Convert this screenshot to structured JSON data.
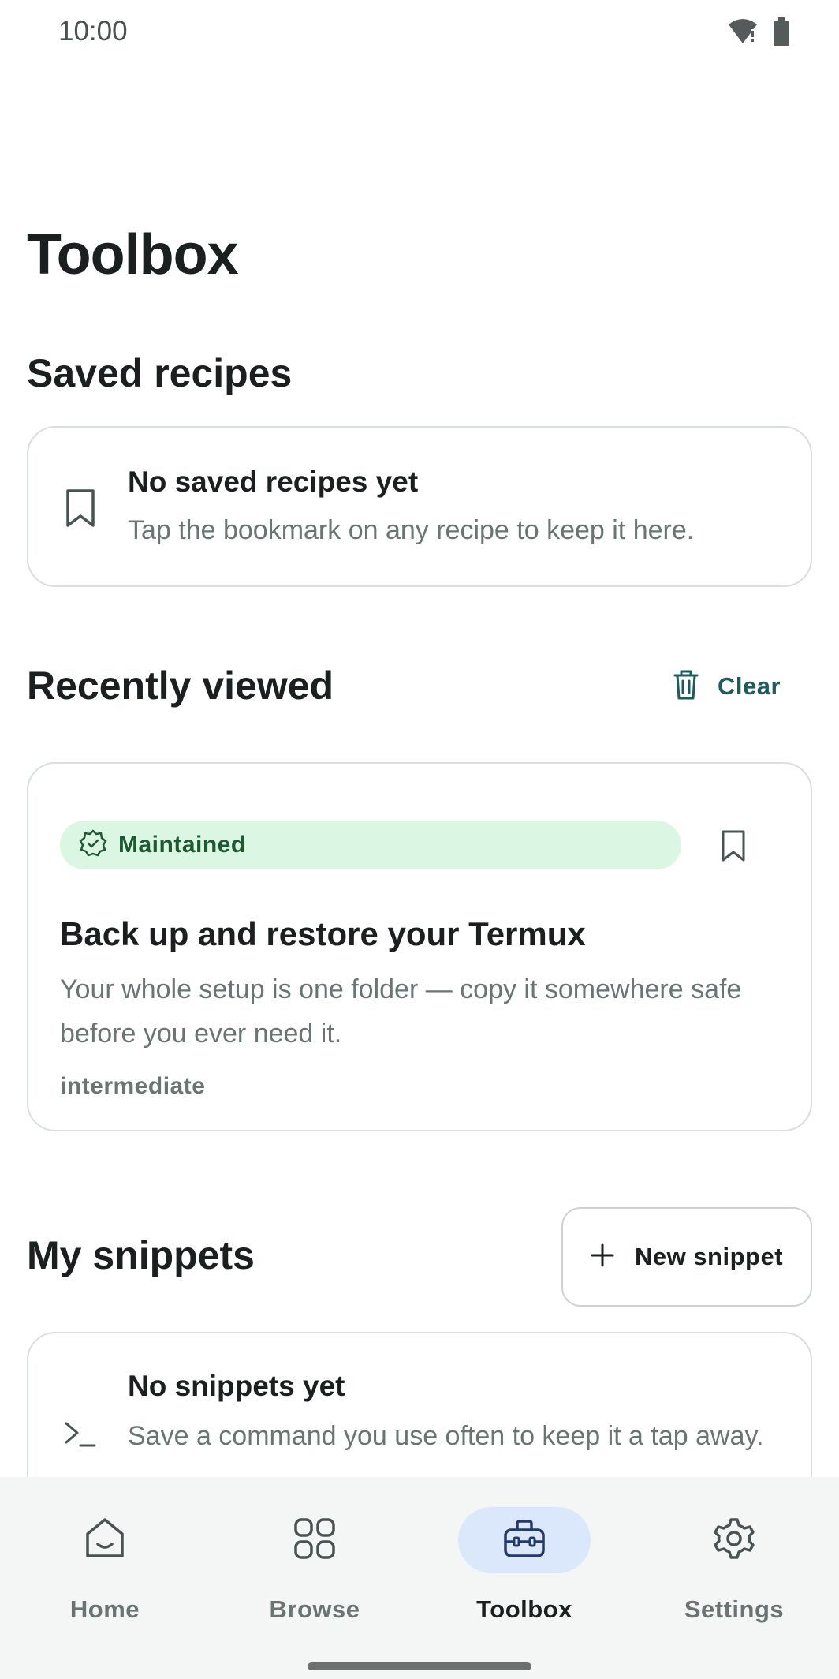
{
  "status_bar": {
    "time": "10:00"
  },
  "page": {
    "title": "Toolbox"
  },
  "saved_recipes": {
    "heading": "Saved recipes",
    "empty_title": "No saved recipes yet",
    "empty_subtitle": "Tap the bookmark on any recipe to keep it here."
  },
  "recently_viewed": {
    "heading": "Recently viewed",
    "clear_label": "Clear",
    "card": {
      "badge": "Maintained",
      "title": "Back up and restore your Termux",
      "description": "Your whole setup is one folder — copy it somewhere safe before you ever need it.",
      "level": "intermediate"
    }
  },
  "my_snippets": {
    "heading": "My snippets",
    "new_button": "New snippet",
    "empty_title": "No snippets yet",
    "empty_subtitle": "Save a command you use often to keep it a tap away."
  },
  "bottom_nav": {
    "items": [
      {
        "label": "Home",
        "icon": "home-icon"
      },
      {
        "label": "Browse",
        "icon": "grid-icon"
      },
      {
        "label": "Toolbox",
        "icon": "toolbox-icon",
        "active": true
      },
      {
        "label": "Settings",
        "icon": "gear-icon"
      }
    ]
  },
  "colors": {
    "accent": "#1f5a5c",
    "badge_bg": "#dbf6e2",
    "badge_text": "#1d5a32",
    "nav_active_bg": "#dbe7fb"
  }
}
